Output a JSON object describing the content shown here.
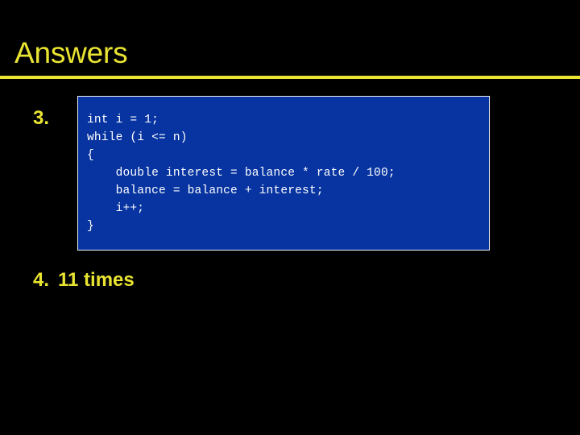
{
  "slide": {
    "title": "Answers",
    "background_color": "#000000",
    "accent_color": "#E9E432"
  },
  "answers": [
    {
      "number": "3.",
      "kind": "code",
      "code_block": {
        "background_color": "#0734A0",
        "border_color": "#F2F2F2",
        "text_color": "#FFFFFF",
        "lines": [
          "int i = 1;",
          "while (i <= n)",
          "{",
          "    double interest = balance * rate / 100;",
          "    balance = balance + interest;",
          "    i++;",
          "}"
        ]
      }
    },
    {
      "number": "4.",
      "kind": "text",
      "text": "11 times"
    }
  ]
}
